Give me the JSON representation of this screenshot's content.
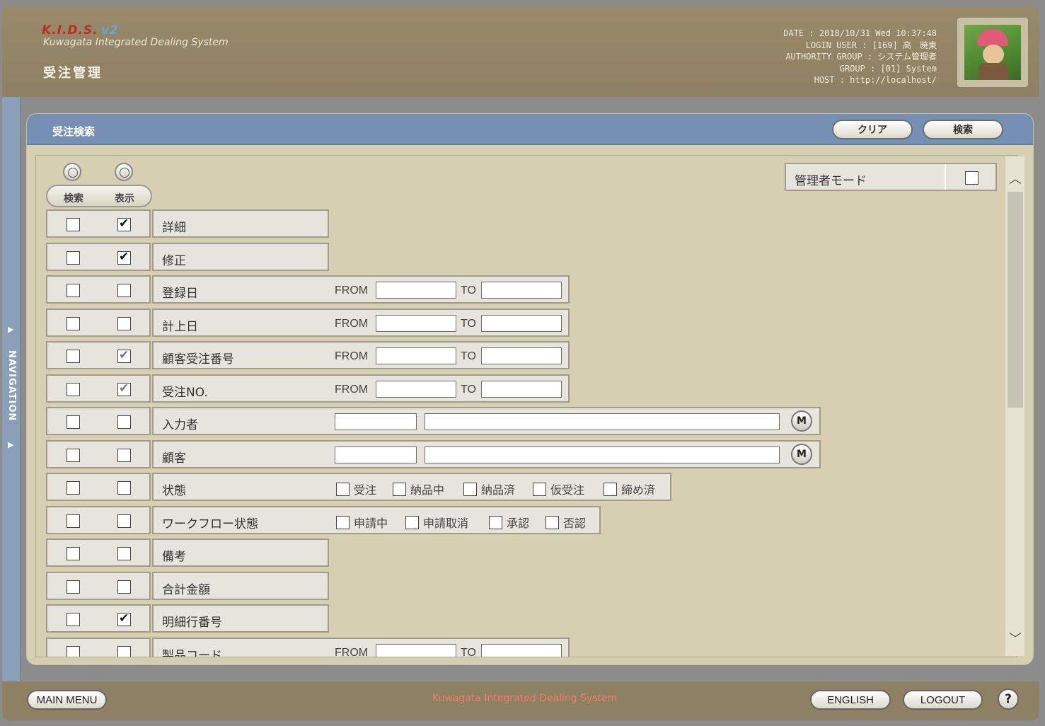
{
  "header": {
    "logo": "K.I.D.S.",
    "logo_version": "v2",
    "subtitle": "Kuwagata Integrated Dealing System",
    "page_title": "受注管理",
    "info": {
      "date": "DATE : 2018/10/31 Wed 10:37:48",
      "login_user": "LOGIN USER : [169] 高　暁東",
      "authority_group": "AUTHORITY GROUP : システム管理者",
      "group": "GROUP : [01] System",
      "host": "HOST : http://localhost/"
    }
  },
  "nav": {
    "label": "NAVIGATION"
  },
  "panel": {
    "title": "受注検索",
    "clear_label": "クリア",
    "search_label": "検索",
    "col_search": "検索",
    "col_display": "表示",
    "admin_mode_label": "管理者モード",
    "range_from": "FROM",
    "range_to": "TO",
    "m_label": "M"
  },
  "rows": [
    {
      "label": "詳細",
      "search": false,
      "display": true
    },
    {
      "label": "修正",
      "search": false,
      "display": true
    },
    {
      "label": "登録日",
      "search": false,
      "display": false
    },
    {
      "label": "計上日",
      "search": false,
      "display": false
    },
    {
      "label": "顧客受注番号",
      "search": false,
      "display": true
    },
    {
      "label": "受注NO.",
      "search": false,
      "display": true
    },
    {
      "label": "入力者",
      "search": false,
      "display": false
    },
    {
      "label": "顧客",
      "search": false,
      "display": false
    },
    {
      "label": "状態",
      "search": false,
      "display": false,
      "options": [
        "受注",
        "納品中",
        "納品済",
        "仮受注",
        "締め済"
      ]
    },
    {
      "label": "ワークフロー状態",
      "search": false,
      "display": false,
      "options": [
        "申請中",
        "申請取消",
        "承認",
        "否認"
      ]
    },
    {
      "label": "備考",
      "search": false,
      "display": false
    },
    {
      "label": "合計金額",
      "search": false,
      "display": false
    },
    {
      "label": "明細行番号",
      "search": false,
      "display": true
    },
    {
      "label": "製品コード",
      "search": false,
      "display": false
    }
  ],
  "footer": {
    "main_menu": "MAIN MENU",
    "center_text": "Kuwagata Integrated Dealing System",
    "english": "ENGLISH",
    "logout": "LOGOUT",
    "help": "?"
  }
}
